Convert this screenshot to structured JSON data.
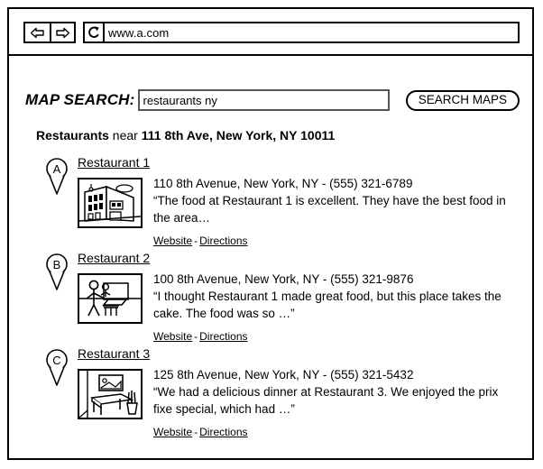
{
  "browser": {
    "back_icon": "arrow-left-icon",
    "forward_icon": "arrow-right-icon",
    "reload_icon": "reload-icon",
    "url": "www.a.com"
  },
  "search": {
    "label": "MAP SEARCH:",
    "value": "restaurants ny",
    "placeholder": "",
    "button_label": "SEARCH MAPS"
  },
  "results_heading": {
    "category": "Restaurants",
    "connector": " near ",
    "location": "111 8th Ave, New York, NY 10011"
  },
  "links": {
    "website": "Website",
    "separator": "-",
    "directions": "Directions"
  },
  "results": [
    {
      "marker": "A",
      "title": "Restaurant 1",
      "thumbnail": "building-exterior-thumbnail",
      "address": "110 8th Avenue, New York, NY - (555) 321-6789",
      "snippet": "“The food at Restaurant 1 is excellent.  They have the best food in the area…"
    },
    {
      "marker": "B",
      "title": "Restaurant 2",
      "thumbnail": "person-at-counter-thumbnail",
      "address": "100 8th Avenue, New York, NY - (555) 321-9876",
      "snippet": "“I thought Restaurant 1 made great food, but this place takes the cake.  The food was so …”"
    },
    {
      "marker": "C",
      "title": "Restaurant 3",
      "thumbnail": "dining-room-interior-thumbnail",
      "address": "125 8th Avenue, New York, NY - (555) 321-5432",
      "snippet": "“We had a delicious dinner at Restaurant 3.  We enjoyed the prix fixe special, which had …”"
    }
  ],
  "colors": {
    "ink": "#000000",
    "paper": "#ffffff",
    "field_border": "#555555"
  }
}
